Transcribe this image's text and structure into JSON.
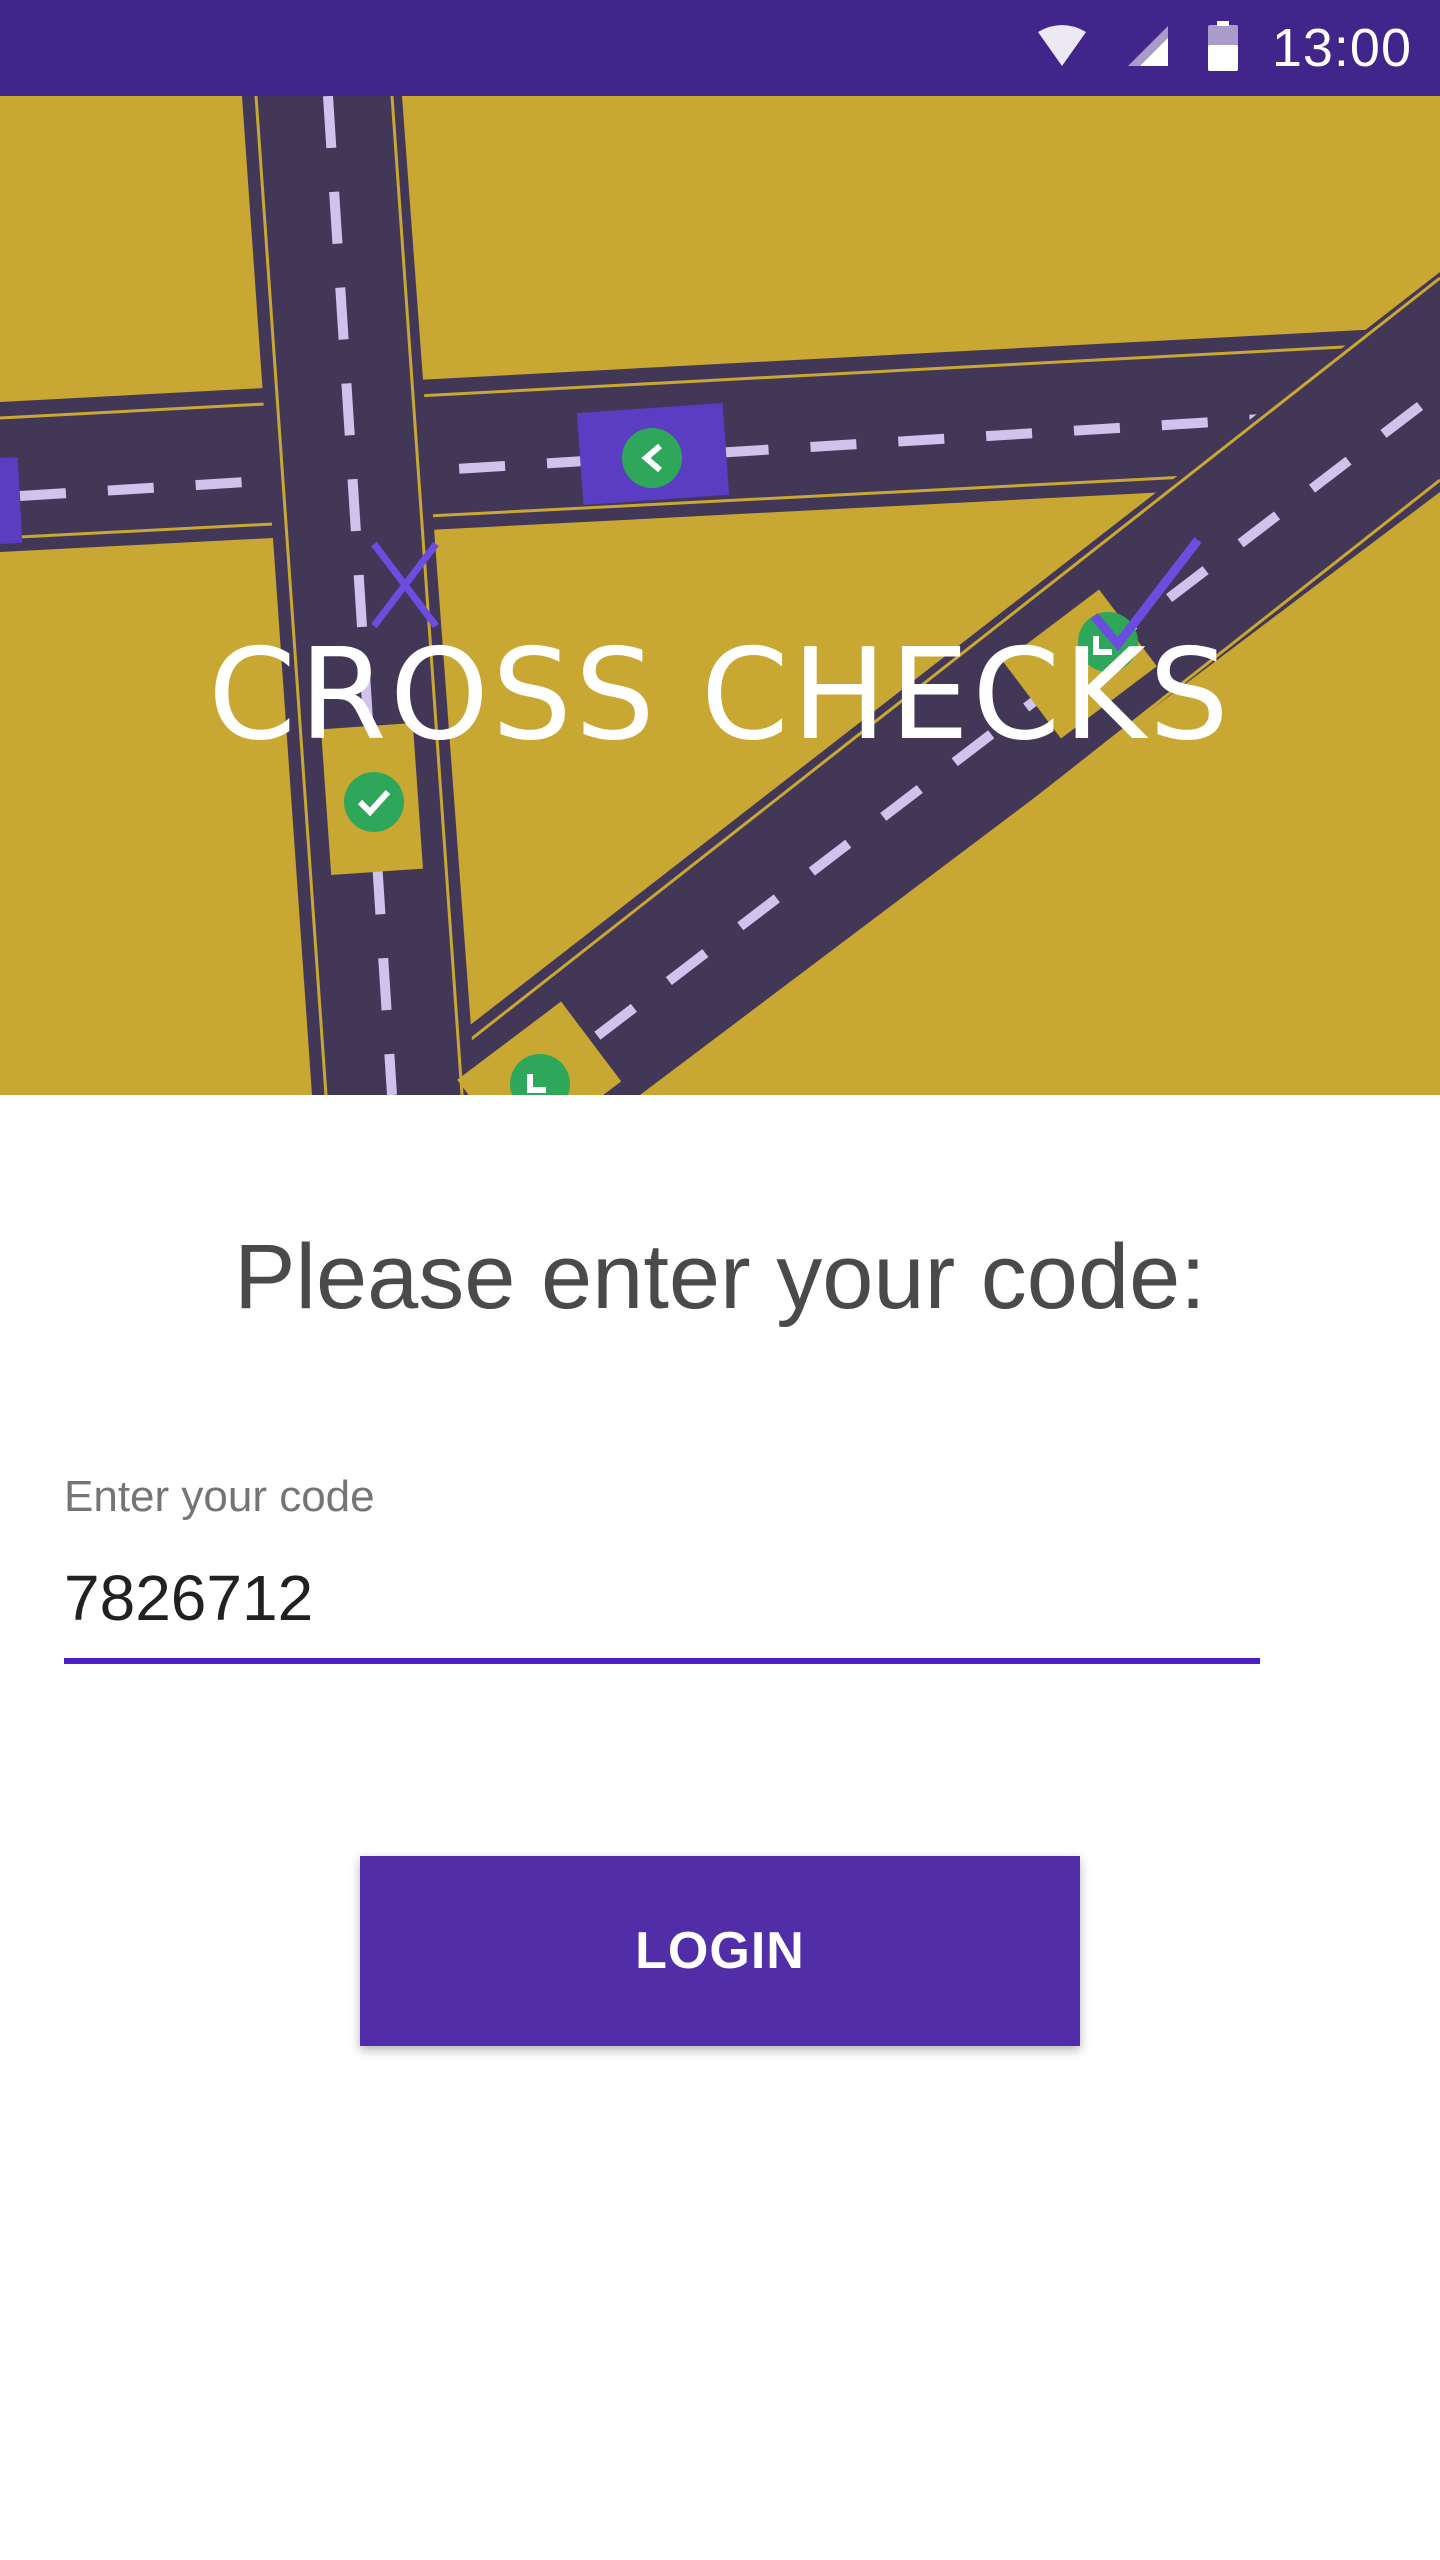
{
  "status_bar": {
    "time": "13:00",
    "icons": [
      "wifi-icon",
      "cell-signal-icon",
      "battery-icon"
    ]
  },
  "hero": {
    "logo_text": "CROSS CHECKS",
    "colors": {
      "background": "#C9A733",
      "road": "#433758",
      "dash": "#CFC2EC",
      "car": "#C9A733",
      "car_purple": "#5B3DC4",
      "badge": "#2EA75B",
      "accent": "#6D4CE0"
    }
  },
  "login": {
    "prompt": "Please enter your code:",
    "field_label": "Enter your code",
    "code_value": "7826712",
    "button_label": "LOGIN"
  },
  "colors": {
    "status_bar": "#42258A",
    "accent": "#4C1FC4",
    "button": "#512DA8"
  }
}
